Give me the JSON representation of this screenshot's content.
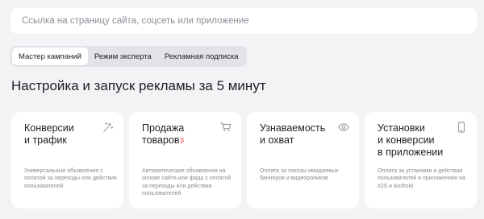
{
  "search": {
    "placeholder": "Ссылка на страницу сайта, соцсеть или приложение"
  },
  "tabs": [
    {
      "label": "Мастер кампаний",
      "active": true
    },
    {
      "label": "Режим эксперта",
      "active": false
    },
    {
      "label": "Рекламная подписка",
      "active": false
    }
  ],
  "headline": "Настройка и запуск рекламы за 5 минут",
  "cards": [
    {
      "title_line1": "Конверсии",
      "title_line2": "и трафик",
      "title_line3": "",
      "badge": "",
      "icon": "magic-wand-icon",
      "description": "Универсальные объявления с оплатой за переходы или действия пользователей"
    },
    {
      "title_line1": "Продажа",
      "title_line2": "товаров",
      "title_line3": "",
      "badge": "β",
      "icon": "cart-icon",
      "description": "Автоматические объявления на основе сайта или фида с оплатой за переходы или действия пользователей"
    },
    {
      "title_line1": "Узнаваемость",
      "title_line2": "и охват",
      "title_line3": "",
      "badge": "",
      "icon": "eye-icon",
      "description": "Оплата за показы имиджевых баннеров и видеороликов"
    },
    {
      "title_line1": "Установки",
      "title_line2": "и конверсии",
      "title_line3": "в приложении",
      "badge": "",
      "icon": "smartphone-icon",
      "description": "Оплата за установки и действия пользователей в приложениях на IOS и Android"
    }
  ],
  "colors": {
    "background": "#f2f3f5",
    "card": "#ffffff",
    "tab_track": "#e1e3e8",
    "icon": "#9a9da5",
    "beta": "#e8473d"
  }
}
